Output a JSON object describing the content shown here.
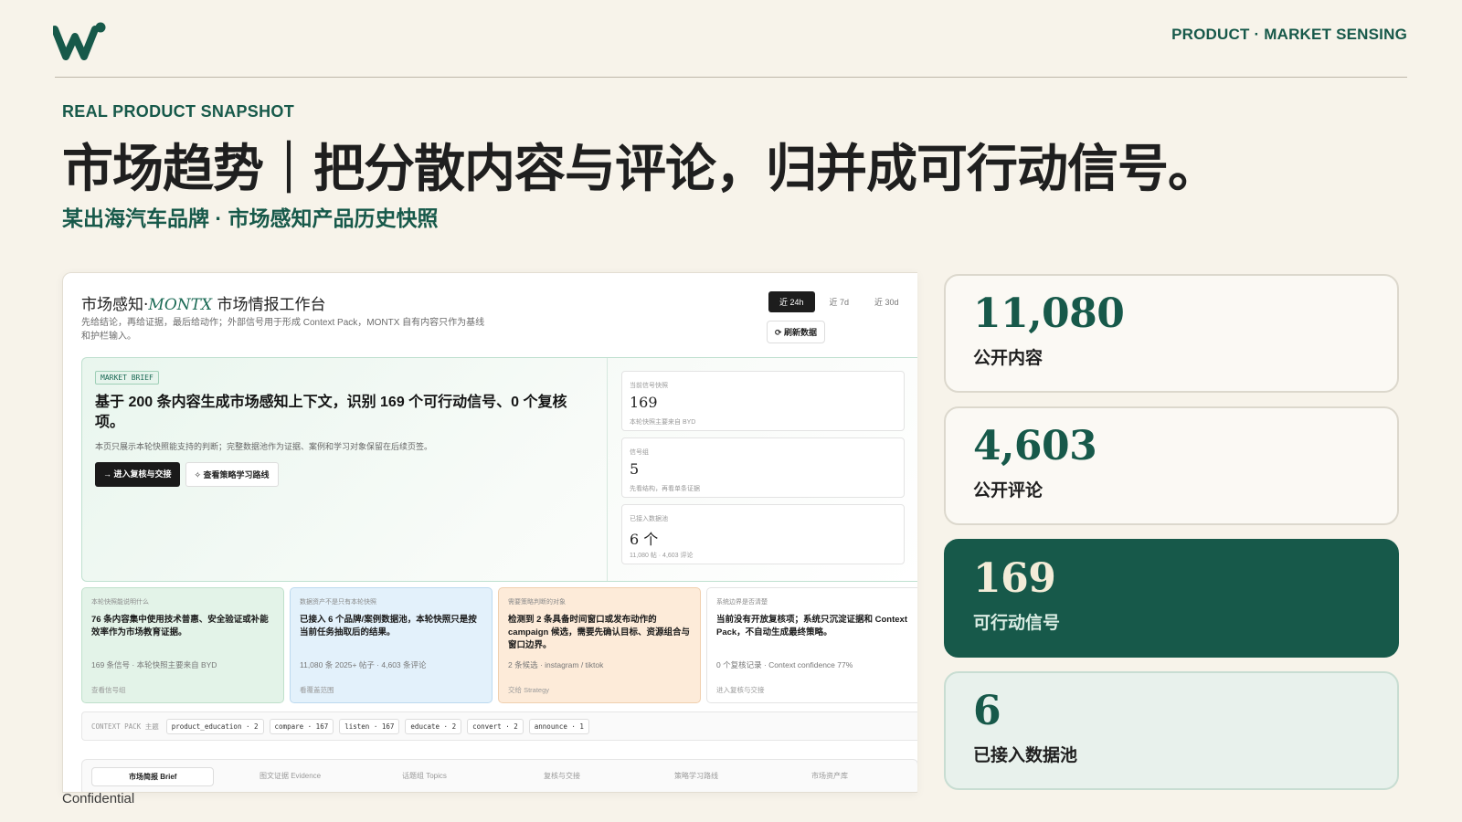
{
  "header": {
    "top_right": "PRODUCT · MARKET SENSING",
    "kicker": "REAL PRODUCT SNAPSHOT",
    "headline": "市场趋势｜把分散内容与评论，归并成可行动信号。",
    "subhead": "某出海汽车品牌 · 市场感知产品历史快照",
    "footer": "Confidential"
  },
  "brand_colors": {
    "accent": "#17594a",
    "background": "#f7f3ea"
  },
  "screenshot": {
    "title_prefix": "市场感知·",
    "title_brand": "MONTX",
    "title_suffix": " 市场情报工作台",
    "description": "先给结论，再给证据，最后给动作；外部信号用于形成 Context Pack，MONTX 自有内容只作为基线和护栏输入。",
    "ranges": [
      "近 24h",
      "近 7d",
      "近 30d"
    ],
    "range_selected": "近 24h",
    "refresh": "⟳ 刷新数据",
    "brief": {
      "tag": "MARKET BRIEF",
      "title": "基于 200 条内容生成市场感知上下文，识别 169 个可行动信号、0 个复核项。",
      "sub": "本页只展示本轮快照能支持的判断；完整数据池作为证据、案例和学习对象保留在后续页签。",
      "primary_button": "→  进入复核与交接",
      "secondary_button": "✧  查看策略学习路线"
    },
    "metrics": [
      {
        "label": "当前信号快照",
        "value": "169",
        "note": "本轮快照主要来自 BYD"
      },
      {
        "label": "信号组",
        "value": "5",
        "note": "先看结构，再看单条证据"
      },
      {
        "label": "已接入数据池",
        "value": "6 个",
        "note": "11,080 帖 · 4,603 评论"
      }
    ],
    "cards": [
      {
        "label": "本轮快照能说明什么",
        "body": "76 条内容集中使用技术普惠、安全验证或补能效率作为市场教育证据。",
        "meta": "169 条信号 · 本轮快照主要来自 BYD",
        "foot": "查看信号组"
      },
      {
        "label": "数据资产不是只有本轮快照",
        "body": "已接入 6 个品牌/案例数据池，本轮快照只是按当前任务抽取后的结果。",
        "meta": "11,080 条 2025+ 帖子 · 4,603 条评论",
        "foot": "看覆盖范围"
      },
      {
        "label": "需要策略判断的对象",
        "body": "检测到 2 条具备时间窗口或发布动作的 campaign 候选，需要先确认目标、资源组合与窗口边界。",
        "meta": "2 条候选 · instagram / tiktok",
        "foot": "交给 Strategy"
      },
      {
        "label": "系统边界是否清楚",
        "body": "当前没有开放复核项；系统只沉淀证据和 Context Pack，不自动生成最终策略。",
        "meta": "0 个复核记录 · Context confidence 77%",
        "foot": "进入复核与交接"
      }
    ],
    "context_pack": {
      "title": "CONTEXT PACK 主题",
      "chips": [
        "product_education · 2",
        "compare · 167",
        "listen · 167",
        "educate · 2",
        "convert · 2",
        "announce · 1"
      ]
    },
    "tabs": [
      "市场简报 Brief",
      "图文证据 Evidence",
      "话题组 Topics",
      "复核与交接",
      "策略学习路线",
      "市场资产库"
    ]
  },
  "stats": [
    {
      "value": "11,080",
      "label": "公开内容"
    },
    {
      "value": "4,603",
      "label": "公开评论"
    },
    {
      "value": "169",
      "label": "可行动信号"
    },
    {
      "value": "6",
      "label": "已接入数据池"
    }
  ]
}
